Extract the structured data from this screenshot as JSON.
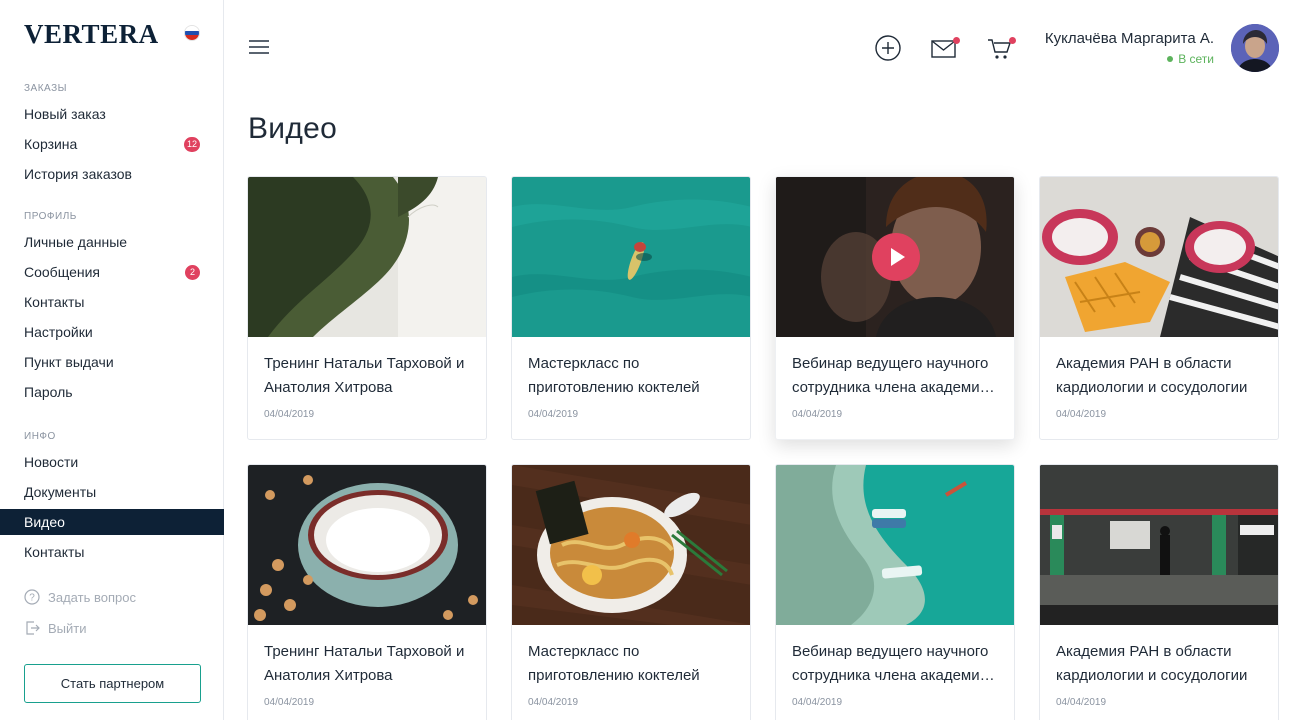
{
  "brand": {
    "logo": "VERTERA",
    "flag": [
      "#ffffff",
      "#1f4fb0",
      "#d52b1e"
    ],
    "accent": "#0d2136",
    "badge_color": "#e0415f",
    "partner_border": "#18a08e"
  },
  "sidebar": {
    "sections": [
      {
        "label": "ЗАКАЗЫ",
        "items": [
          {
            "label": "Новый заказ"
          },
          {
            "label": "Корзина",
            "badge": "12"
          },
          {
            "label": "История заказов"
          }
        ]
      },
      {
        "label": "ПРОФИЛЬ",
        "items": [
          {
            "label": "Личные данные"
          },
          {
            "label": "Сообщения",
            "badge": "2"
          },
          {
            "label": "Контакты"
          },
          {
            "label": "Настройки"
          },
          {
            "label": "Пункт выдачи"
          },
          {
            "label": "Пароль"
          }
        ]
      },
      {
        "label": "ИНФО",
        "items": [
          {
            "label": "Новости"
          },
          {
            "label": "Документы"
          },
          {
            "label": "Видео",
            "active": true
          },
          {
            "label": "Контакты"
          }
        ]
      }
    ],
    "ask_question": "Задать вопрос",
    "logout": "Выйти",
    "partner_button": "Стать партнером"
  },
  "header": {
    "icons": [
      "menu-icon",
      "add-circle-icon",
      "mail-icon",
      "cart-icon"
    ],
    "user_name": "Куклачёва Маргарита А.",
    "user_status": "В сети"
  },
  "page": {
    "title": "Видео"
  },
  "videos": [
    {
      "title": "Тренинг Натальи Тарховой и Анатолия Хитрова",
      "date": "04/04/2019",
      "image": "leaf"
    },
    {
      "title": "Мастеркласс по приготовлению коктелей",
      "date": "04/04/2019",
      "image": "sea-swimmer"
    },
    {
      "title": "Вебинар ведущего научного сотрудника члена академи…",
      "date": "04/04/2019",
      "image": "portrait",
      "playing": true
    },
    {
      "title": "Академия РАН в области кардиологии и сосудологии",
      "date": "04/04/2019",
      "image": "fruits"
    },
    {
      "title": "Тренинг Натальи Тарховой и Анатолия Хитрова",
      "date": "04/04/2019",
      "image": "milk-bowl"
    },
    {
      "title": "Мастеркласс по приготовлению коктелей",
      "date": "04/04/2019",
      "image": "ramen"
    },
    {
      "title": "Вебинар ведущего научного сотрудника члена академи…",
      "date": "04/04/2019",
      "image": "boats"
    },
    {
      "title": "Академия РАН в области кардиологии и сосудологии",
      "date": "04/04/2019",
      "image": "subway"
    }
  ]
}
